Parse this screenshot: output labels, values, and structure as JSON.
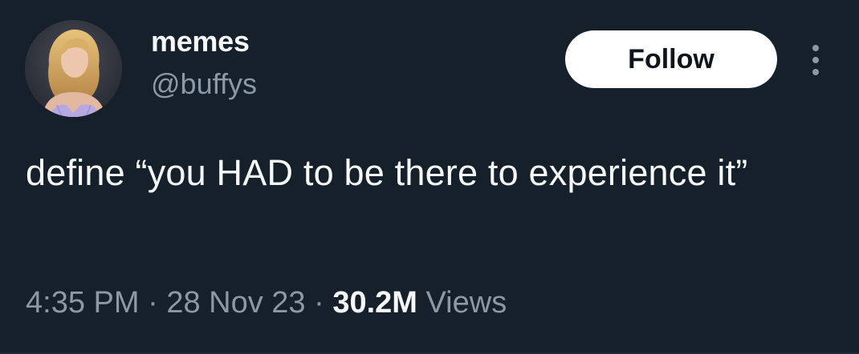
{
  "colors": {
    "background": "#15202b",
    "primary_text": "#f7f9f9",
    "secondary_text": "#8b98a5",
    "follow_button_bg": "#ffffff",
    "follow_button_text": "#0f1419"
  },
  "author": {
    "display_name": "memes",
    "handle": "@buffys",
    "avatar_icon": "profile-photo"
  },
  "actions": {
    "follow_label": "Follow",
    "more_icon": "more-vertical-icon"
  },
  "tweet": {
    "text": "define “you HAD to be there to experience it”"
  },
  "meta": {
    "time": "4:35 PM",
    "separator": "·",
    "date": "28 Nov 23",
    "views_count": "30.2M",
    "views_label": "Views"
  }
}
